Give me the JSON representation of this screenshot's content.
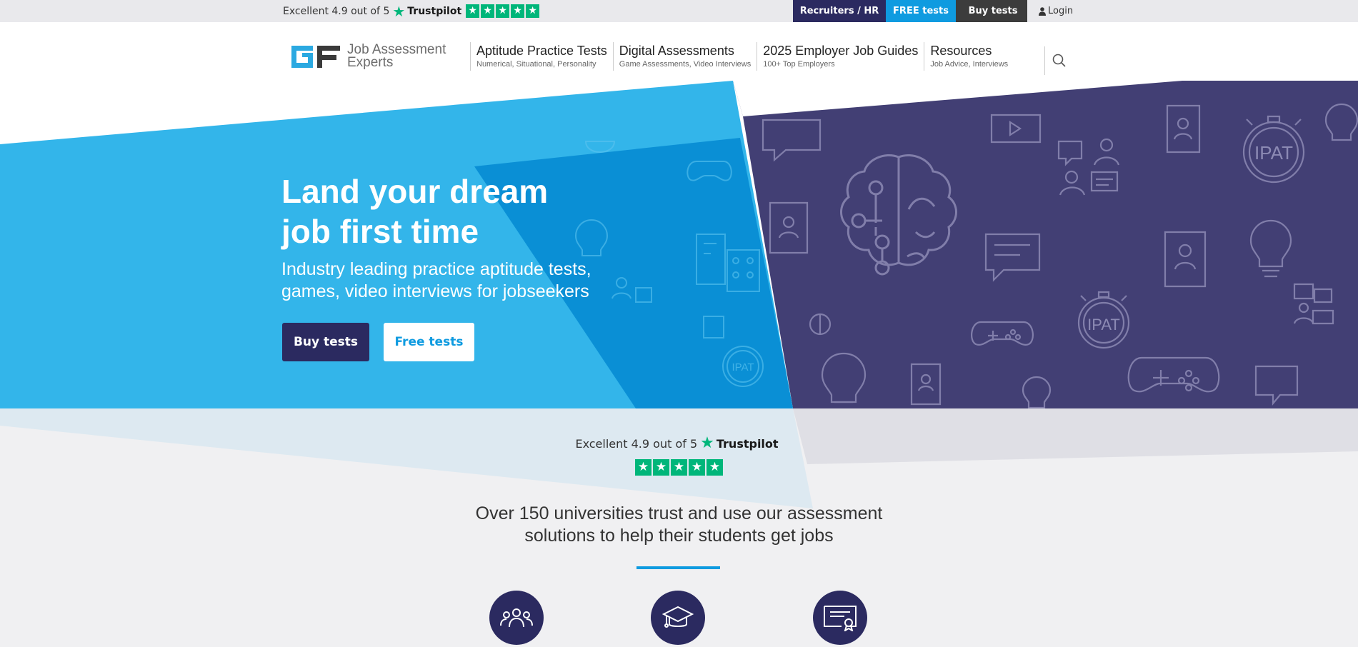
{
  "topbar": {
    "trustpilot": {
      "text": "Excellent 4.9 out of 5",
      "brand": "Trustpilot"
    },
    "links": {
      "recruiters": "Recruiters / HR",
      "free": "FREE tests",
      "buy": "Buy tests",
      "login": "Login"
    }
  },
  "header": {
    "logo": {
      "line1": "Job Assessment",
      "line2": "Experts"
    },
    "nav": [
      {
        "title": "Aptitude Practice Tests",
        "sub": "Numerical, Situational, Personality"
      },
      {
        "title": "Digital Assessments",
        "sub": "Game Assessments, Video Interviews"
      },
      {
        "title": "2025 Employer Job Guides",
        "sub": "100+ Top Employers"
      },
      {
        "title": "Resources",
        "sub": "Job Advice, Interviews"
      }
    ]
  },
  "hero": {
    "title_line1": "Land your dream",
    "title_line2": "job first time",
    "sub_line1": "Industry leading practice aptitude tests,",
    "sub_line2": "games, video interviews for jobseekers",
    "buy_label": "Buy tests",
    "free_label": "Free tests",
    "icon_labels": {
      "ipat": "IPAT"
    }
  },
  "trust": {
    "text": "Excellent 4.9 out of 5",
    "brand": "Trustpilot",
    "headline_line1": "Over 150 universities trust and use our assessment",
    "headline_line2": "solutions to help their students get jobs"
  },
  "colors": {
    "navy": "#2b2a60",
    "blue": "#0f9be0",
    "trustpilot_green": "#00b67a",
    "purple_bg": "#423f74",
    "light_blue": "#33b5ea"
  },
  "icons": [
    "trustpilot-star-icon",
    "cart-icon",
    "user-icon",
    "search-icon",
    "brain-icon",
    "people-icon",
    "graduation-cap-icon",
    "certificate-icon"
  ]
}
